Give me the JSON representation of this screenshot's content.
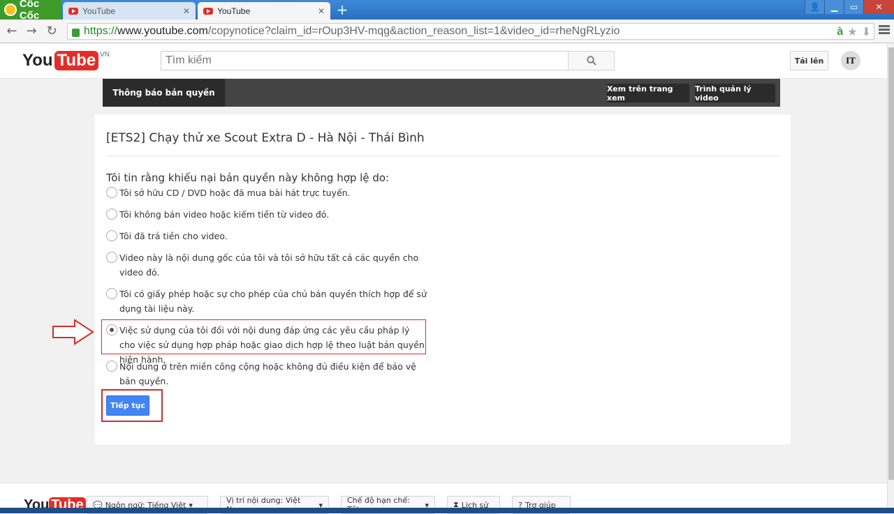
{
  "browser": {
    "brand": "Cốc Cốc",
    "tabs": [
      {
        "title": "YouTube",
        "active": false
      },
      {
        "title": "YouTube",
        "active": true
      }
    ],
    "url": {
      "scheme": "https://",
      "host": "www.youtube.com",
      "path": "/copynotice?claim_id=rOup3HV-mqg&action_reason_list=1&video_id=rheNgRLyzio"
    }
  },
  "header": {
    "logo_you": "You",
    "logo_tube": "Tube",
    "country": "VN",
    "search_placeholder": "Tìm kiếm",
    "upload_label": "Tải lên",
    "avatar_text": "IT"
  },
  "copyright_bar": {
    "title": "Thông báo bản quyền",
    "watch_button": "Xem trên trang xem",
    "manager_button": "Trình quản lý video"
  },
  "form": {
    "video_title": "[ETS2] Chạy thử xe Scout Extra D - Hà Nội - Thái Bình",
    "prompt": "Tôi tin rằng khiếu nại bản quyền này không hợp lệ do:",
    "options": [
      {
        "label": "Tôi sở hữu CD / DVD hoặc đã mua bài hát trực tuyến.",
        "checked": false
      },
      {
        "label": "Tôi không bán video hoặc kiếm tiền từ video đó.",
        "checked": false
      },
      {
        "label": "Tôi đã trả tiền cho video.",
        "checked": false
      },
      {
        "label": "Video này là nội dung gốc của tôi và tôi sở hữu tất cả các quyền cho video đó.",
        "checked": false
      },
      {
        "label": "Tôi có giấy phép hoặc sự cho phép của chủ bản quyền thích hợp để sử dụng tài liệu này.",
        "checked": false
      },
      {
        "label": "Việc sử dụng của tôi đối với nội dung đáp ứng các yêu cầu pháp lý cho việc sử dụng hợp pháp hoặc giao dịch hợp lệ theo luật bản quyền hiện hành.",
        "checked": true
      },
      {
        "label": "Nội dung ở trên miền công cộng hoặc không đủ điều kiện để bảo vệ bản quyền.",
        "checked": false
      }
    ],
    "continue_label": "Tiếp tục"
  },
  "footer": {
    "language": "Ngôn ngữ: Tiếng Việt",
    "location": "Vị trí nội dung: Việt Nam",
    "restricted": "Chế độ hạn chế: Tắt",
    "history": "Lịch sử",
    "help": "Trợ giúp"
  },
  "colors": {
    "youtube_red": "#e52d27",
    "button_blue": "#4285f4",
    "annotation_red": "#d62b2b",
    "dark_bar": "#444444"
  }
}
